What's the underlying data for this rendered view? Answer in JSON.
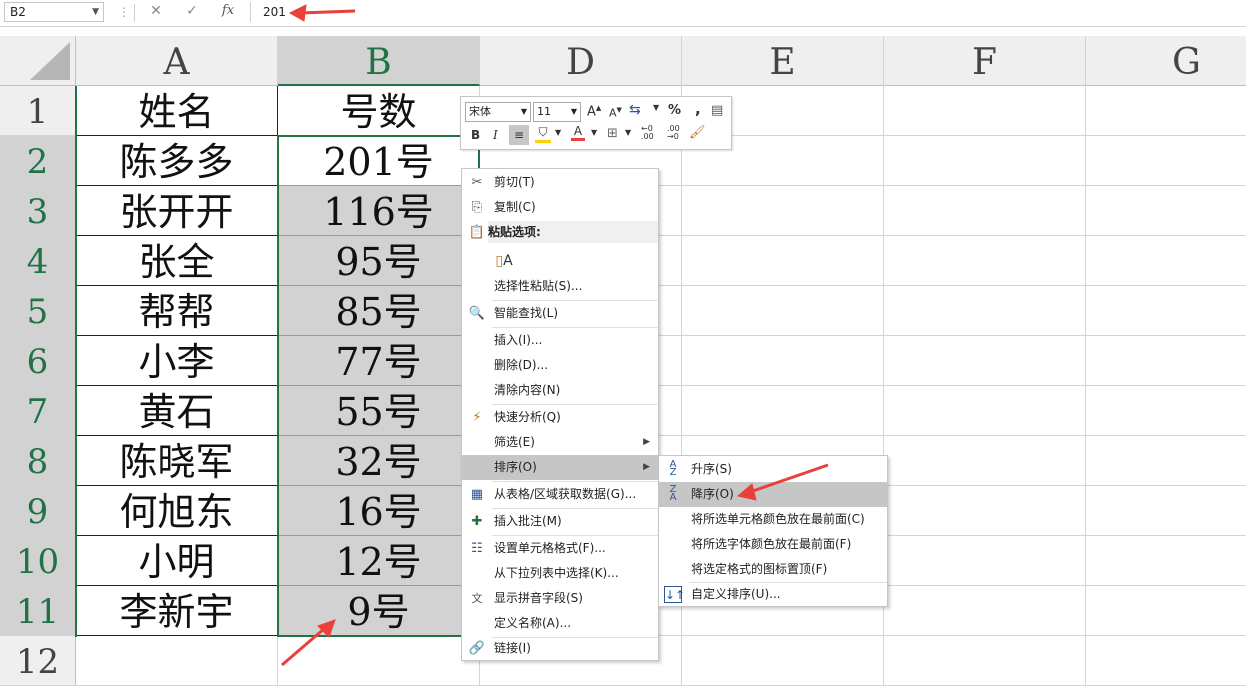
{
  "formula_bar": {
    "name_box": "B2",
    "cancel_icon": "✕",
    "enter_icon": "✓",
    "fx_icon": "fx",
    "value": "201"
  },
  "columns": [
    "A",
    "B",
    "D",
    "E",
    "F",
    "G"
  ],
  "rows": [
    "1",
    "2",
    "3",
    "4",
    "5",
    "6",
    "7",
    "8",
    "9",
    "10",
    "11",
    "12"
  ],
  "cells": {
    "A": [
      "姓名",
      "陈多多",
      "张开开",
      "张全",
      "帮帮",
      "小李",
      "黄石",
      "陈晓军",
      "何旭东",
      "小明",
      "李新宇"
    ],
    "B": [
      "号数",
      "201号",
      "116号",
      "95号",
      "85号",
      "77号",
      "55号",
      "32号",
      "16号",
      "12号",
      "9号"
    ]
  },
  "mini_toolbar": {
    "font_name": "宋体",
    "font_size": "11",
    "grow_font": "A",
    "shrink_font": "A",
    "percent": "%",
    "comma": ",",
    "bold": "B",
    "italic": "I",
    "font_color_letter": "A",
    "font_color": "#e8403a",
    "fill_color": "#ffd000"
  },
  "context_menu": {
    "items": [
      {
        "label": "剪切(T)",
        "icon": "✂"
      },
      {
        "label": "复制(C)",
        "icon": "⎘"
      },
      {
        "label": "粘贴选项:",
        "icon": "📋"
      },
      {
        "label": "选择性粘贴(S)..."
      },
      {
        "label": "智能查找(L)",
        "icon": "🔍"
      },
      {
        "label": "插入(I)..."
      },
      {
        "label": "删除(D)..."
      },
      {
        "label": "清除内容(N)"
      },
      {
        "label": "快速分析(Q)",
        "icon": "⚡"
      },
      {
        "label": "筛选(E)",
        "arrow": "▶"
      },
      {
        "label": "排序(O)",
        "arrow": "▶"
      },
      {
        "label": "从表格/区域获取数据(G)...",
        "icon": "▦"
      },
      {
        "label": "插入批注(M)",
        "icon": "✚"
      },
      {
        "label": "设置单元格格式(F)...",
        "icon": "☷"
      },
      {
        "label": "从下拉列表中选择(K)..."
      },
      {
        "label": "显示拼音字段(S)",
        "icon": "文"
      },
      {
        "label": "定义名称(A)..."
      },
      {
        "label": "链接(I)",
        "icon": "🔗"
      }
    ],
    "paste_icon_letter": "A"
  },
  "sort_submenu": {
    "items": [
      {
        "label": "升序(S)",
        "icon_top": "A",
        "icon_bottom": "Z"
      },
      {
        "label": "降序(O)",
        "icon_top": "Z",
        "icon_bottom": "A"
      },
      {
        "label": "将所选单元格颜色放在最前面(C)"
      },
      {
        "label": "将所选字体颜色放在最前面(F)"
      },
      {
        "label": "将选定格式的图标置顶(F)"
      },
      {
        "label": "自定义排序(U)...",
        "icon_top": "↓↑"
      }
    ]
  },
  "colors": {
    "accent_green": "#217346",
    "annotation_red": "#e8403a",
    "selection_gray": "#d2d2d2"
  }
}
